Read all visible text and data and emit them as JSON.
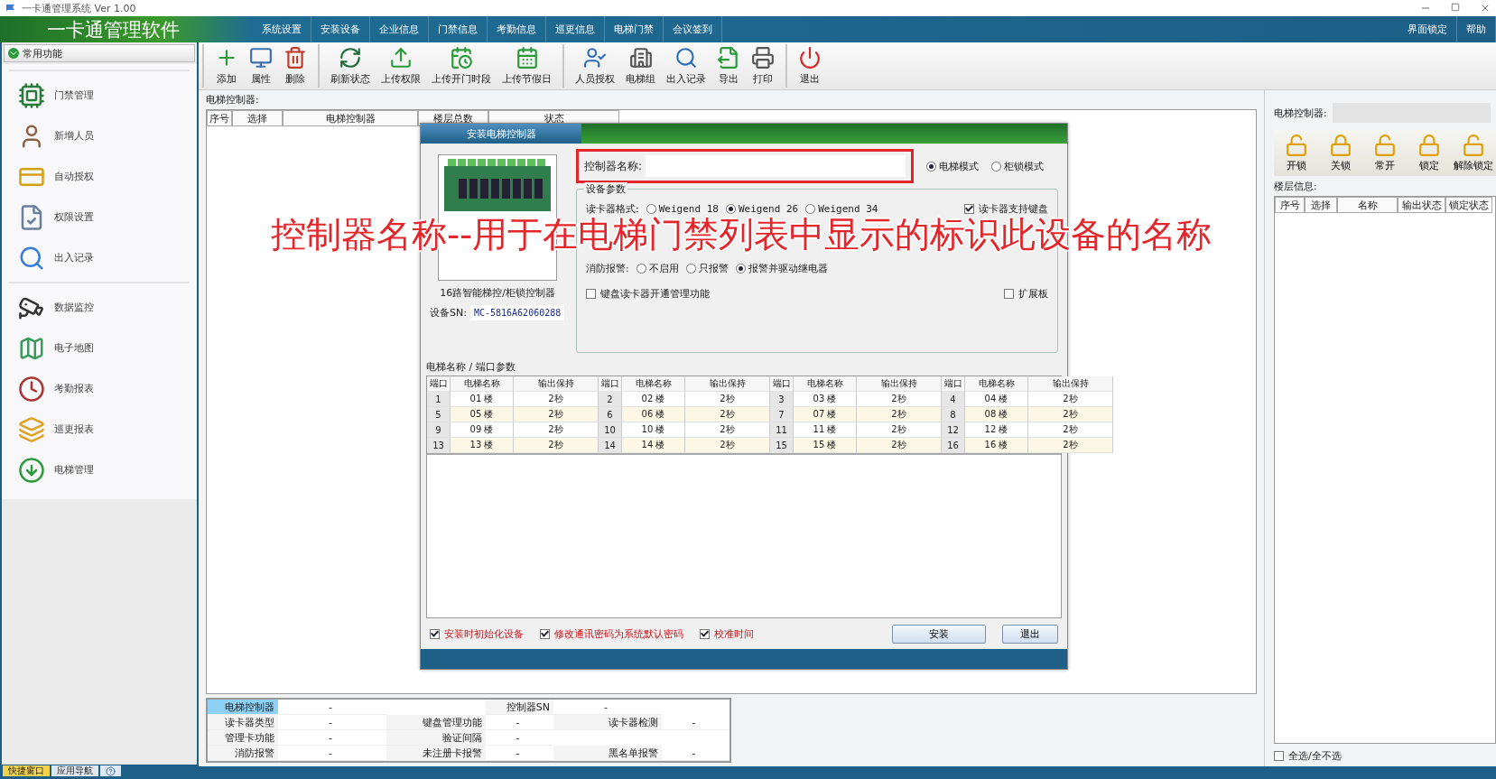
{
  "window": {
    "title": "一卡通管理系统 Ver 1.00"
  },
  "menu_bar": {
    "app_name": "一卡通管理软件",
    "items": [
      "系统设置",
      "安装设备",
      "企业信息",
      "门禁信息",
      "考勤信息",
      "巡更信息",
      "电梯门禁",
      "会议签到"
    ],
    "right_items": [
      "界面锁定",
      "帮助"
    ]
  },
  "toolbar": {
    "groups": [
      [
        "添加",
        "属性",
        "删除"
      ],
      [
        "刷新状态",
        "上传权限",
        "上传开门时段",
        "上传节假日"
      ],
      [
        "人员授权",
        "电梯组",
        "出入记录",
        "导出",
        "打印"
      ],
      [
        "退出"
      ]
    ]
  },
  "sidebar": {
    "header": "常用功能",
    "groups": [
      [
        "门禁管理",
        "新增人员",
        "自动授权",
        "权限设置",
        "出入记录"
      ],
      [
        "数据监控",
        "电子地图",
        "考勤报表",
        "巡更报表",
        "电梯管理"
      ]
    ],
    "bottom_tabs": [
      {
        "kind": "text",
        "label": "快捷窗口",
        "selected": true
      },
      {
        "kind": "text",
        "label": "应用导航",
        "selected": false
      },
      {
        "kind": "icon",
        "selected": false
      }
    ]
  },
  "main": {
    "label": "电梯控制器:",
    "table": {
      "columns": [
        "序号",
        "选择",
        "电梯控制器",
        "楼层总数",
        "状态"
      ]
    }
  },
  "info_table": {
    "rows": [
      [
        {
          "kind": "label",
          "text": "电梯控制器",
          "selected": true
        },
        {
          "kind": "value",
          "text": "-"
        },
        {
          "kind": "empty"
        },
        {
          "kind": "label",
          "text": "控制器SN",
          "selected": false
        },
        {
          "kind": "value",
          "text": "-"
        },
        {
          "kind": "empty"
        }
      ],
      [
        {
          "kind": "label",
          "text": "读卡器类型",
          "selected": false
        },
        {
          "kind": "value",
          "text": "-"
        },
        {
          "kind": "label",
          "text": "键盘管理功能",
          "selected": false
        },
        {
          "kind": "value",
          "text": "-"
        },
        {
          "kind": "label",
          "text": "读卡器检测",
          "selected": false
        },
        {
          "kind": "value",
          "text": "-"
        }
      ],
      [
        {
          "kind": "label",
          "text": "管理卡功能",
          "selected": false
        },
        {
          "kind": "value",
          "text": "-"
        },
        {
          "kind": "label",
          "text": "验证间隔",
          "selected": false
        },
        {
          "kind": "value",
          "text": "-"
        },
        {
          "kind": "empty"
        },
        {
          "kind": "empty"
        }
      ],
      [
        {
          "kind": "label",
          "text": "消防报警",
          "selected": false
        },
        {
          "kind": "value",
          "text": "-"
        },
        {
          "kind": "label",
          "text": "未注册卡报警",
          "selected": false
        },
        {
          "kind": "value",
          "text": "-"
        },
        {
          "kind": "label",
          "text": "黑名单报警",
          "selected": false
        },
        {
          "kind": "value",
          "text": "-"
        }
      ]
    ]
  },
  "dialog": {
    "title": "安装电梯控制器",
    "device_caption": "16路智能梯控/柜锁控制器",
    "sn_label": "设备SN:",
    "sn_value": "MC-5816A62060288",
    "name_field": {
      "label": "控制器名称:",
      "highlighted": true
    },
    "modes": [
      {
        "label": "电梯模式",
        "selected": true
      },
      {
        "label": "柜锁模式",
        "selected": false
      }
    ],
    "group_title": "设备参数",
    "reader_format": {
      "label": "读卡器格式:",
      "options": [
        {
          "label": "Weigend 18",
          "selected": false
        },
        {
          "label": "Weigend 26",
          "selected": true
        },
        {
          "label": "Weigend 34",
          "selected": false
        }
      ]
    },
    "keyboard_support": {
      "label": "读卡器支持键盘",
      "checked": true
    },
    "fire_alarm": {
      "label": "消防报警:",
      "options": [
        {
          "label": "不启用",
          "selected": false
        },
        {
          "label": "只报警",
          "selected": false
        },
        {
          "label": "报警并驱动继电器",
          "selected": true
        }
      ]
    },
    "keyboard_admin": {
      "label": "键盘读卡器开通管理功能",
      "checked": false
    },
    "expansion": {
      "label": "扩展板",
      "checked": false
    },
    "ports_label": "电梯名称 / 端口参数",
    "ports_header": [
      "端口",
      "电梯名称",
      "输出保持",
      "端口",
      "电梯名称",
      "输出保持",
      "端口",
      "电梯名称",
      "输出保持",
      "端口",
      "电梯名称",
      "输出保持"
    ],
    "ports": [
      [
        {
          "port": "1",
          "name": "01 楼",
          "hold": "2秒"
        },
        {
          "port": "2",
          "name": "02 楼",
          "hold": "2秒"
        },
        {
          "port": "3",
          "name": "03 楼",
          "hold": "2秒"
        },
        {
          "port": "4",
          "name": "04 楼",
          "hold": "2秒"
        }
      ],
      [
        {
          "port": "5",
          "name": "05 楼",
          "hold": "2秒"
        },
        {
          "port": "6",
          "name": "06 楼",
          "hold": "2秒"
        },
        {
          "port": "7",
          "name": "07 楼",
          "hold": "2秒"
        },
        {
          "port": "8",
          "name": "08 楼",
          "hold": "2秒"
        }
      ],
      [
        {
          "port": "9",
          "name": "09 楼",
          "hold": "2秒"
        },
        {
          "port": "10",
          "name": "10 楼",
          "hold": "2秒"
        },
        {
          "port": "11",
          "name": "11 楼",
          "hold": "2秒"
        },
        {
          "port": "12",
          "name": "12 楼",
          "hold": "2秒"
        }
      ],
      [
        {
          "port": "13",
          "name": "13 楼",
          "hold": "2秒"
        },
        {
          "port": "14",
          "name": "14 楼",
          "hold": "2秒"
        },
        {
          "port": "15",
          "name": "15 楼",
          "hold": "2秒"
        },
        {
          "port": "16",
          "name": "16 楼",
          "hold": "2秒"
        }
      ]
    ],
    "options": [
      {
        "label": "安装时初始化设备",
        "checked": true
      },
      {
        "label": "修改通讯密码为系统默认密码",
        "checked": true
      },
      {
        "label": "校准时间",
        "checked": true
      }
    ],
    "buttons": [
      "安装",
      "退出"
    ]
  },
  "right_panel": {
    "controller_label": "电梯控制器:",
    "lock_buttons": [
      {
        "label": "开锁",
        "locked": false
      },
      {
        "label": "关锁",
        "locked": true
      },
      {
        "label": "常开",
        "locked": false
      },
      {
        "label": "锁定",
        "locked": true
      },
      {
        "label": "解除锁定",
        "locked": false
      }
    ],
    "floor_label": "楼层信息:",
    "columns": [
      "序号",
      "选择",
      "名称",
      "输出状态",
      "锁定状态"
    ],
    "select_all": {
      "label": "全选/全不选",
      "checked": false
    }
  },
  "caption": "控制器名称--用于在电梯门禁列表中显示的标识此设备的名称"
}
